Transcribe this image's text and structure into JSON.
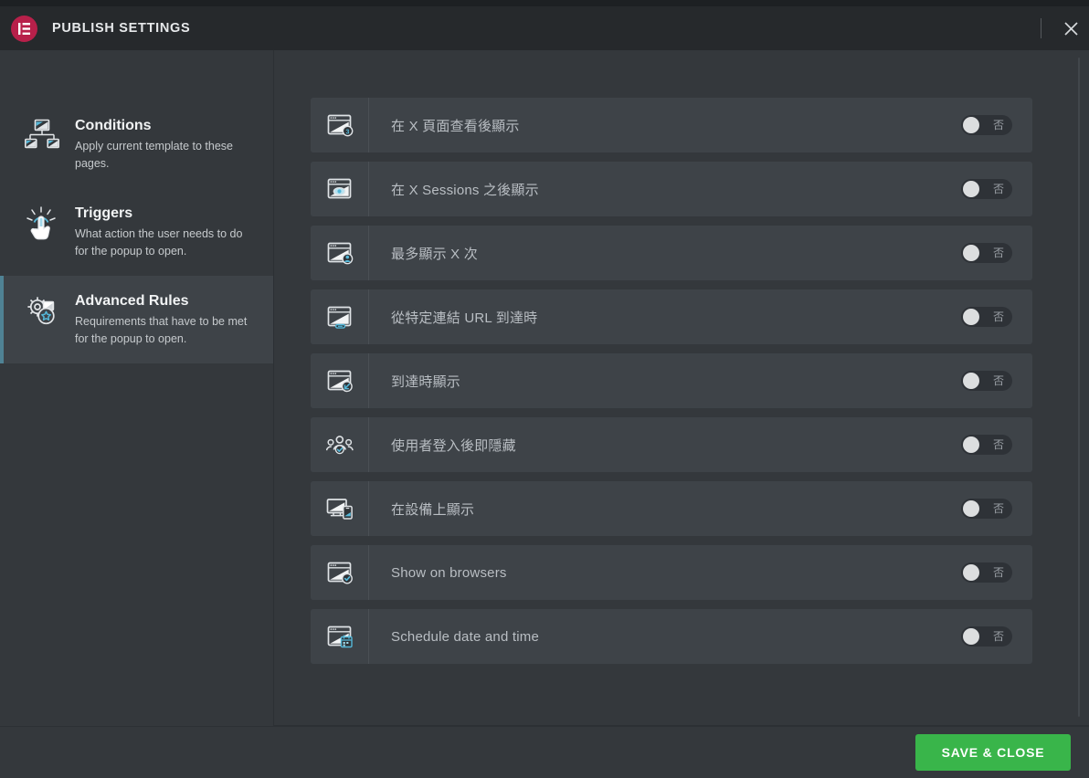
{
  "window": {
    "title": "PUBLISH SETTINGS",
    "brand_icon": "elementor-logo-icon",
    "brand_color": "#b7204a",
    "close_icon": "close-icon"
  },
  "sidebar": {
    "items": [
      {
        "id": "conditions",
        "icon": "sitemap-screens-icon",
        "title": "Conditions",
        "desc": "Apply current template to these pages.",
        "active": false
      },
      {
        "id": "triggers",
        "icon": "click-hand-icon",
        "title": "Triggers",
        "desc": "What action the user needs to do for the popup to open.",
        "active": false
      },
      {
        "id": "advanced-rules",
        "icon": "gear-star-icon",
        "title": "Advanced Rules",
        "desc": "Requirements that have to be met for the popup to open.",
        "active": true
      }
    ],
    "active_accent": "#4f8294"
  },
  "main": {
    "rules": [
      {
        "id": "show-after-x-page-views",
        "icon": "browser-badge-3-icon",
        "label": "在 X 頁面查看後顯示",
        "switch_label": "否",
        "on": false
      },
      {
        "id": "show-after-x-sessions",
        "icon": "browser-eye-icon",
        "label": "在 X Sessions 之後顯示",
        "switch_label": "否",
        "on": false
      },
      {
        "id": "show-up-to-x-times",
        "icon": "browser-user-icon",
        "label": "最多顯示 X 次",
        "switch_label": "否",
        "on": false
      },
      {
        "id": "when-arriving-from-url",
        "icon": "browser-link-icon",
        "label": "從特定連結 URL 到達時",
        "switch_label": "否",
        "on": false
      },
      {
        "id": "show-on-arrival",
        "icon": "browser-arrow-icon",
        "label": "到達時顯示",
        "switch_label": "否",
        "on": false
      },
      {
        "id": "hide-for-logged-in",
        "icon": "users-group-icon",
        "label": "使用者登入後即隱藏",
        "switch_label": "否",
        "on": false
      },
      {
        "id": "show-on-devices",
        "icon": "devices-icon",
        "label": "在設備上顯示",
        "switch_label": "否",
        "on": false
      },
      {
        "id": "show-on-browsers",
        "icon": "browser-check-icon",
        "label": "Show on browsers",
        "switch_label": "否",
        "on": false
      },
      {
        "id": "schedule-date-and-time",
        "icon": "browser-calendar-icon",
        "label": "Schedule date and time",
        "switch_label": "否",
        "on": false
      }
    ]
  },
  "footer": {
    "save_label": "SAVE & CLOSE",
    "save_color": "#39b54a"
  }
}
